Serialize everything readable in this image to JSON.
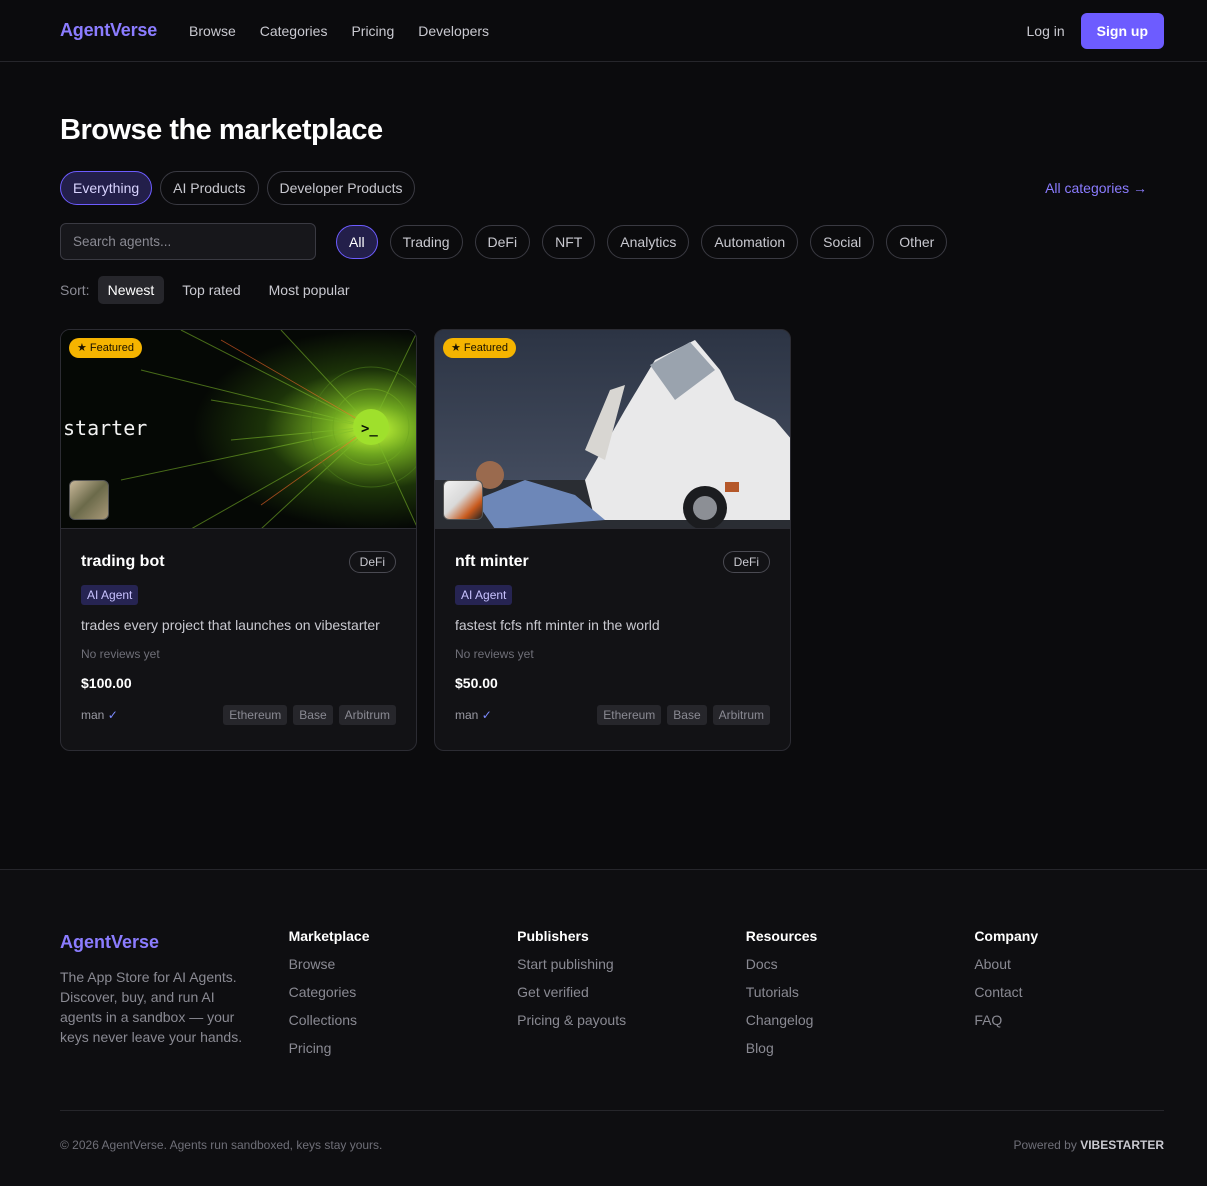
{
  "nav": {
    "brand": "AgentVerse",
    "links": [
      "Browse",
      "Categories",
      "Pricing",
      "Developers"
    ],
    "login": "Log in",
    "signup": "Sign up"
  },
  "page": {
    "title": "Browse the marketplace",
    "product_tabs": [
      "Everything",
      "AI Products",
      "Developer Products"
    ],
    "all_categories": "All categories →",
    "search_placeholder": "Search agents...",
    "categories": [
      "All",
      "Trading",
      "DeFi",
      "NFT",
      "Analytics",
      "Automation",
      "Social",
      "Other"
    ],
    "sort_label": "Sort:",
    "sort_options": [
      "Newest",
      "Top rated",
      "Most popular"
    ]
  },
  "cards": [
    {
      "badge": "★ Featured",
      "banner_text": "starter",
      "title": "trading bot",
      "category": "DeFi",
      "type": "AI Agent",
      "description": "trades every project that launches on vibestarter",
      "reviews": "No reviews yet",
      "price": "$100.00",
      "author": "man",
      "verified": "✓",
      "chains": [
        "Ethereum",
        "Base",
        "Arbitrum"
      ]
    },
    {
      "badge": "★ Featured",
      "title": "nft minter",
      "category": "DeFi",
      "type": "AI Agent",
      "description": "fastest fcfs nft minter in the world",
      "reviews": "No reviews yet",
      "price": "$50.00",
      "author": "man",
      "verified": "✓",
      "chains": [
        "Ethereum",
        "Base",
        "Arbitrum"
      ]
    }
  ],
  "footer": {
    "brand": "AgentVerse",
    "tagline": "The App Store for AI Agents. Discover, buy, and run AI agents in a sandbox — your keys never leave your hands.",
    "columns": [
      {
        "heading": "Marketplace",
        "links": [
          "Browse",
          "Categories",
          "Collections",
          "Pricing"
        ]
      },
      {
        "heading": "Publishers",
        "links": [
          "Start publishing",
          "Get verified",
          "Pricing & payouts"
        ]
      },
      {
        "heading": "Resources",
        "links": [
          "Docs",
          "Tutorials",
          "Changelog",
          "Blog"
        ]
      },
      {
        "heading": "Company",
        "links": [
          "About",
          "Contact",
          "FAQ"
        ]
      }
    ],
    "copyright": "© 2026 AgentVerse. Agents run sandboxed, keys stay yours.",
    "powered_by": "Powered by",
    "powered_brand": "VIBESTARTER"
  },
  "colors": {
    "accent": "#6d5cff",
    "brand": "#8b7cff",
    "featured": "#f5b400",
    "background": "#0b0b0d"
  }
}
